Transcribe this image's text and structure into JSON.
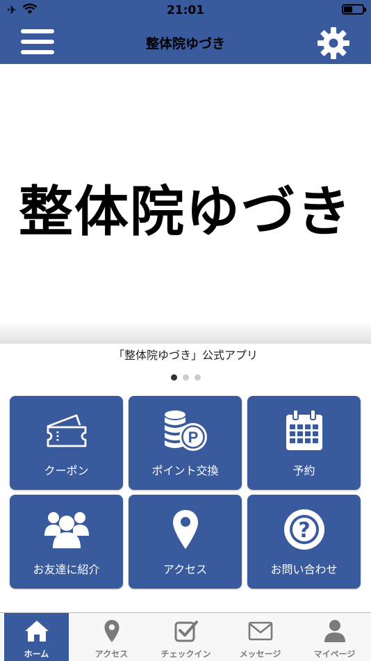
{
  "status_bar": {
    "time": "21:01"
  },
  "header": {
    "title": "整体院ゆづき"
  },
  "banner": {
    "logo_text": "整体院ゆづき",
    "caption": "「整体院ゆづき」公式アプリ",
    "slide_count": 3,
    "active_slide": 1
  },
  "tiles": [
    {
      "label": "クーポン",
      "icon": "ticket-icon"
    },
    {
      "label": "ポイント交換",
      "icon": "coins-point-icon"
    },
    {
      "label": "予約",
      "icon": "calendar-icon"
    },
    {
      "label": "お友達に紹介",
      "icon": "group-icon"
    },
    {
      "label": "アクセス",
      "icon": "map-pin-icon"
    },
    {
      "label": "お問い合わせ",
      "icon": "question-icon"
    }
  ],
  "tabbar": [
    {
      "label": "ホーム",
      "icon": "home-icon",
      "active": true
    },
    {
      "label": "アクセス",
      "icon": "map-pin-icon",
      "active": false
    },
    {
      "label": "チェックイン",
      "icon": "checkin-icon",
      "active": false
    },
    {
      "label": "メッセージ",
      "icon": "envelope-icon",
      "active": false
    },
    {
      "label": "マイページ",
      "icon": "person-icon",
      "active": false
    }
  ],
  "colors": {
    "primary": "#3a5a9e",
    "tab_inactive": "#7a7a7a",
    "tabbar_bg": "#f7f7f7"
  }
}
